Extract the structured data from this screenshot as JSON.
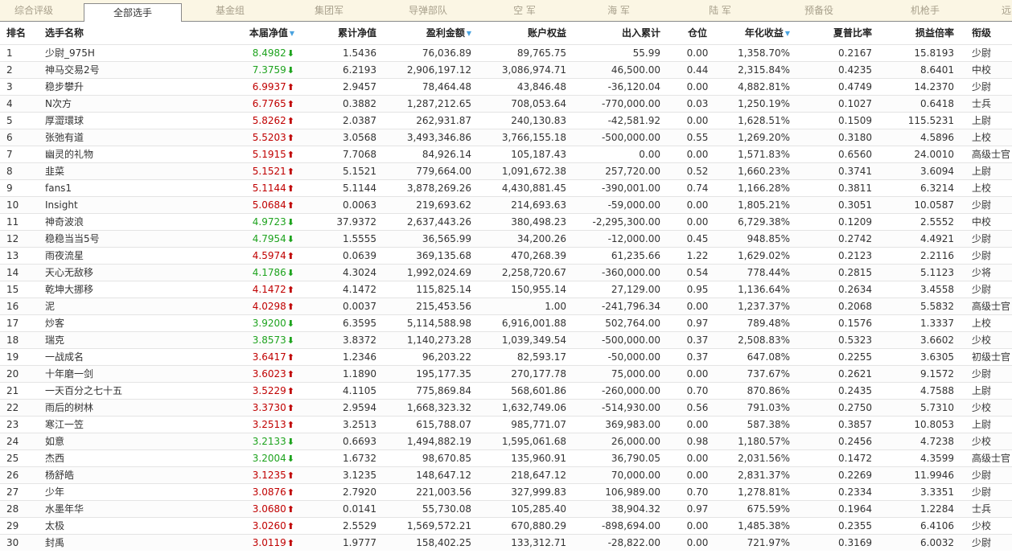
{
  "tabs": [
    {
      "label": "综合评级",
      "active": false
    },
    {
      "label": "全部选手",
      "active": true
    },
    {
      "label": "基金组",
      "active": false
    },
    {
      "label": "集团军",
      "active": false
    },
    {
      "label": "导弹部队",
      "active": false
    },
    {
      "label": "空  军",
      "active": false
    },
    {
      "label": "海  军",
      "active": false
    },
    {
      "label": "陆  军",
      "active": false
    },
    {
      "label": "预备役",
      "active": false
    },
    {
      "label": "机枪手",
      "active": false
    },
    {
      "label": "远",
      "active": false
    }
  ],
  "columns": {
    "rank": "排名",
    "name": "选手名称",
    "nav": "本届净值",
    "cum_nav": "累计净值",
    "profit": "盈利金额",
    "equity": "账户权益",
    "inout": "出入累计",
    "position": "仓位",
    "annual": "年化收益",
    "sharpe": "夏普比率",
    "pl_ratio": "损益倍率",
    "title": "衔级"
  },
  "sortable": [
    "nav",
    "profit",
    "annual"
  ],
  "colors": {
    "up": "#c00000",
    "down": "#1ea31e",
    "sort": "#4aa3df"
  },
  "rows": [
    {
      "rank": "1",
      "name": "少尉_975H",
      "nav": "8.4982",
      "dir": "down",
      "cum_nav": "1.5436",
      "profit": "76,036.89",
      "equity": "89,765.75",
      "inout": "55.99",
      "position": "0.00",
      "annual": "1,358.70%",
      "sharpe": "0.2167",
      "pl_ratio": "15.8193",
      "title": "少尉"
    },
    {
      "rank": "2",
      "name": "神马交易2号",
      "nav": "7.3759",
      "dir": "down",
      "cum_nav": "6.2193",
      "profit": "2,906,197.12",
      "equity": "3,086,974.71",
      "inout": "46,500.00",
      "position": "0.44",
      "annual": "2,315.84%",
      "sharpe": "0.4235",
      "pl_ratio": "8.6401",
      "title": "中校"
    },
    {
      "rank": "3",
      "name": "稳步攀升",
      "nav": "6.9937",
      "dir": "up",
      "cum_nav": "2.9457",
      "profit": "78,464.48",
      "equity": "43,846.48",
      "inout": "-36,120.04",
      "position": "0.00",
      "annual": "4,882.81%",
      "sharpe": "0.4749",
      "pl_ratio": "14.2370",
      "title": "少尉"
    },
    {
      "rank": "4",
      "name": "N次方",
      "nav": "6.7765",
      "dir": "up",
      "cum_nav": "0.3882",
      "profit": "1,287,212.65",
      "equity": "708,053.64",
      "inout": "-770,000.00",
      "position": "0.03",
      "annual": "1,250.19%",
      "sharpe": "0.1027",
      "pl_ratio": "0.6418",
      "title": "士兵"
    },
    {
      "rank": "5",
      "name": "厚澀環球",
      "nav": "5.8262",
      "dir": "up",
      "cum_nav": "2.0387",
      "profit": "262,931.87",
      "equity": "240,130.83",
      "inout": "-42,581.92",
      "position": "0.00",
      "annual": "1,628.51%",
      "sharpe": "0.1509",
      "pl_ratio": "115.5231",
      "title": "上尉"
    },
    {
      "rank": "6",
      "name": "张弛有道",
      "nav": "5.5203",
      "dir": "up",
      "cum_nav": "3.0568",
      "profit": "3,493,346.86",
      "equity": "3,766,155.18",
      "inout": "-500,000.00",
      "position": "0.55",
      "annual": "1,269.20%",
      "sharpe": "0.3180",
      "pl_ratio": "4.5896",
      "title": "上校"
    },
    {
      "rank": "7",
      "name": "幽灵的礼物",
      "nav": "5.1915",
      "dir": "up",
      "cum_nav": "7.7068",
      "profit": "84,926.14",
      "equity": "105,187.43",
      "inout": "0.00",
      "position": "0.00",
      "annual": "1,571.83%",
      "sharpe": "0.6560",
      "pl_ratio": "24.0010",
      "title": "高级士官"
    },
    {
      "rank": "8",
      "name": "韭菜",
      "nav": "5.1521",
      "dir": "up",
      "cum_nav": "5.1521",
      "profit": "779,664.00",
      "equity": "1,091,672.38",
      "inout": "257,720.00",
      "position": "0.52",
      "annual": "1,660.23%",
      "sharpe": "0.3741",
      "pl_ratio": "3.6094",
      "title": "上尉"
    },
    {
      "rank": "9",
      "name": "fans1",
      "nav": "5.1144",
      "dir": "up",
      "cum_nav": "5.1144",
      "profit": "3,878,269.26",
      "equity": "4,430,881.45",
      "inout": "-390,001.00",
      "position": "0.74",
      "annual": "1,166.28%",
      "sharpe": "0.3811",
      "pl_ratio": "6.3214",
      "title": "上校"
    },
    {
      "rank": "10",
      "name": "Insight",
      "nav": "5.0684",
      "dir": "up",
      "cum_nav": "0.0063",
      "profit": "219,693.62",
      "equity": "214,693.63",
      "inout": "-59,000.00",
      "position": "0.00",
      "annual": "1,805.21%",
      "sharpe": "0.3051",
      "pl_ratio": "10.0587",
      "title": "少尉"
    },
    {
      "rank": "11",
      "name": "神奇波浪",
      "nav": "4.9723",
      "dir": "down",
      "cum_nav": "37.9372",
      "profit": "2,637,443.26",
      "equity": "380,498.23",
      "inout": "-2,295,300.00",
      "position": "0.00",
      "annual": "6,729.38%",
      "sharpe": "0.1209",
      "pl_ratio": "2.5552",
      "title": "中校"
    },
    {
      "rank": "12",
      "name": "稳稳当当5号",
      "nav": "4.7954",
      "dir": "down",
      "cum_nav": "1.5555",
      "profit": "36,565.99",
      "equity": "34,200.26",
      "inout": "-12,000.00",
      "position": "0.45",
      "annual": "948.85%",
      "sharpe": "0.2742",
      "pl_ratio": "4.4921",
      "title": "少尉"
    },
    {
      "rank": "13",
      "name": "雨夜流星",
      "nav": "4.5974",
      "dir": "up",
      "cum_nav": "0.0639",
      "profit": "369,135.68",
      "equity": "470,268.39",
      "inout": "61,235.66",
      "position": "1.22",
      "annual": "1,629.02%",
      "sharpe": "0.2123",
      "pl_ratio": "2.2116",
      "title": "少尉"
    },
    {
      "rank": "14",
      "name": "天心无敌移",
      "nav": "4.1786",
      "dir": "down",
      "cum_nav": "4.3024",
      "profit": "1,992,024.69",
      "equity": "2,258,720.67",
      "inout": "-360,000.00",
      "position": "0.54",
      "annual": "778.44%",
      "sharpe": "0.2815",
      "pl_ratio": "5.1123",
      "title": "少将"
    },
    {
      "rank": "15",
      "name": "乾坤大挪移",
      "nav": "4.1472",
      "dir": "up",
      "cum_nav": "4.1472",
      "profit": "115,825.14",
      "equity": "150,955.14",
      "inout": "27,129.00",
      "position": "0.95",
      "annual": "1,136.64%",
      "sharpe": "0.2634",
      "pl_ratio": "3.4558",
      "title": "少尉"
    },
    {
      "rank": "16",
      "name": "泥",
      "nav": "4.0298",
      "dir": "up",
      "cum_nav": "0.0037",
      "profit": "215,453.56",
      "equity": "1.00",
      "inout": "-241,796.34",
      "position": "0.00",
      "annual": "1,237.37%",
      "sharpe": "0.2068",
      "pl_ratio": "5.5832",
      "title": "高级士官"
    },
    {
      "rank": "17",
      "name": "炒客",
      "nav": "3.9200",
      "dir": "down",
      "cum_nav": "6.3595",
      "profit": "5,114,588.98",
      "equity": "6,916,001.88",
      "inout": "502,764.00",
      "position": "0.97",
      "annual": "789.48%",
      "sharpe": "0.1576",
      "pl_ratio": "1.3337",
      "title": "上校"
    },
    {
      "rank": "18",
      "name": "瑞克",
      "nav": "3.8573",
      "dir": "down",
      "cum_nav": "3.8372",
      "profit": "1,140,273.28",
      "equity": "1,039,349.54",
      "inout": "-500,000.00",
      "position": "0.37",
      "annual": "2,508.83%",
      "sharpe": "0.5323",
      "pl_ratio": "3.6602",
      "title": "少校"
    },
    {
      "rank": "19",
      "name": "一战成名",
      "nav": "3.6417",
      "dir": "up",
      "cum_nav": "1.2346",
      "profit": "96,203.22",
      "equity": "82,593.17",
      "inout": "-50,000.00",
      "position": "0.37",
      "annual": "647.08%",
      "sharpe": "0.2255",
      "pl_ratio": "3.6305",
      "title": "初级士官"
    },
    {
      "rank": "20",
      "name": "十年磨一剑",
      "nav": "3.6023",
      "dir": "up",
      "cum_nav": "1.1890",
      "profit": "195,177.35",
      "equity": "270,177.78",
      "inout": "75,000.00",
      "position": "0.00",
      "annual": "737.67%",
      "sharpe": "0.2621",
      "pl_ratio": "9.1572",
      "title": "少尉"
    },
    {
      "rank": "21",
      "name": "一天百分之七十五",
      "nav": "3.5229",
      "dir": "up",
      "cum_nav": "4.1105",
      "profit": "775,869.84",
      "equity": "568,601.86",
      "inout": "-260,000.00",
      "position": "0.70",
      "annual": "870.86%",
      "sharpe": "0.2435",
      "pl_ratio": "4.7588",
      "title": "上尉"
    },
    {
      "rank": "22",
      "name": "雨后的树林",
      "nav": "3.3730",
      "dir": "up",
      "cum_nav": "2.9594",
      "profit": "1,668,323.32",
      "equity": "1,632,749.06",
      "inout": "-514,930.00",
      "position": "0.56",
      "annual": "791.03%",
      "sharpe": "0.2750",
      "pl_ratio": "5.7310",
      "title": "少校"
    },
    {
      "rank": "23",
      "name": "寒江一笠",
      "nav": "3.2513",
      "dir": "up",
      "cum_nav": "3.2513",
      "profit": "615,788.07",
      "equity": "985,771.07",
      "inout": "369,983.00",
      "position": "0.00",
      "annual": "587.38%",
      "sharpe": "0.3857",
      "pl_ratio": "10.8053",
      "title": "上尉"
    },
    {
      "rank": "24",
      "name": "如意",
      "nav": "3.2133",
      "dir": "down",
      "cum_nav": "0.6693",
      "profit": "1,494,882.19",
      "equity": "1,595,061.68",
      "inout": "26,000.00",
      "position": "0.98",
      "annual": "1,180.57%",
      "sharpe": "0.2456",
      "pl_ratio": "4.7238",
      "title": "少校"
    },
    {
      "rank": "25",
      "name": "杰西",
      "nav": "3.2004",
      "dir": "down",
      "cum_nav": "1.6732",
      "profit": "98,670.85",
      "equity": "135,960.91",
      "inout": "36,790.05",
      "position": "0.00",
      "annual": "2,031.56%",
      "sharpe": "0.1472",
      "pl_ratio": "4.3599",
      "title": "高级士官"
    },
    {
      "rank": "26",
      "name": "杨舒皓",
      "nav": "3.1235",
      "dir": "up",
      "cum_nav": "3.1235",
      "profit": "148,647.12",
      "equity": "218,647.12",
      "inout": "70,000.00",
      "position": "0.00",
      "annual": "2,831.37%",
      "sharpe": "0.2269",
      "pl_ratio": "11.9946",
      "title": "少尉"
    },
    {
      "rank": "27",
      "name": "少年",
      "nav": "3.0876",
      "dir": "up",
      "cum_nav": "2.7920",
      "profit": "221,003.56",
      "equity": "327,999.83",
      "inout": "106,989.00",
      "position": "0.70",
      "annual": "1,278.81%",
      "sharpe": "0.2334",
      "pl_ratio": "3.3351",
      "title": "少尉"
    },
    {
      "rank": "28",
      "name": "水墨年华",
      "nav": "3.0680",
      "dir": "up",
      "cum_nav": "0.0141",
      "profit": "55,730.08",
      "equity": "105,285.40",
      "inout": "38,904.32",
      "position": "0.97",
      "annual": "675.59%",
      "sharpe": "0.1964",
      "pl_ratio": "1.2284",
      "title": "士兵"
    },
    {
      "rank": "29",
      "name": "太极",
      "nav": "3.0260",
      "dir": "up",
      "cum_nav": "2.5529",
      "profit": "1,569,572.21",
      "equity": "670,880.29",
      "inout": "-898,694.00",
      "position": "0.00",
      "annual": "1,485.38%",
      "sharpe": "0.2355",
      "pl_ratio": "6.4106",
      "title": "少校"
    },
    {
      "rank": "30",
      "name": "封禹",
      "nav": "3.0119",
      "dir": "up",
      "cum_nav": "1.9777",
      "profit": "158,402.25",
      "equity": "133,312.71",
      "inout": "-28,822.00",
      "position": "0.00",
      "annual": "721.97%",
      "sharpe": "0.3169",
      "pl_ratio": "6.0032",
      "title": "少尉"
    }
  ]
}
